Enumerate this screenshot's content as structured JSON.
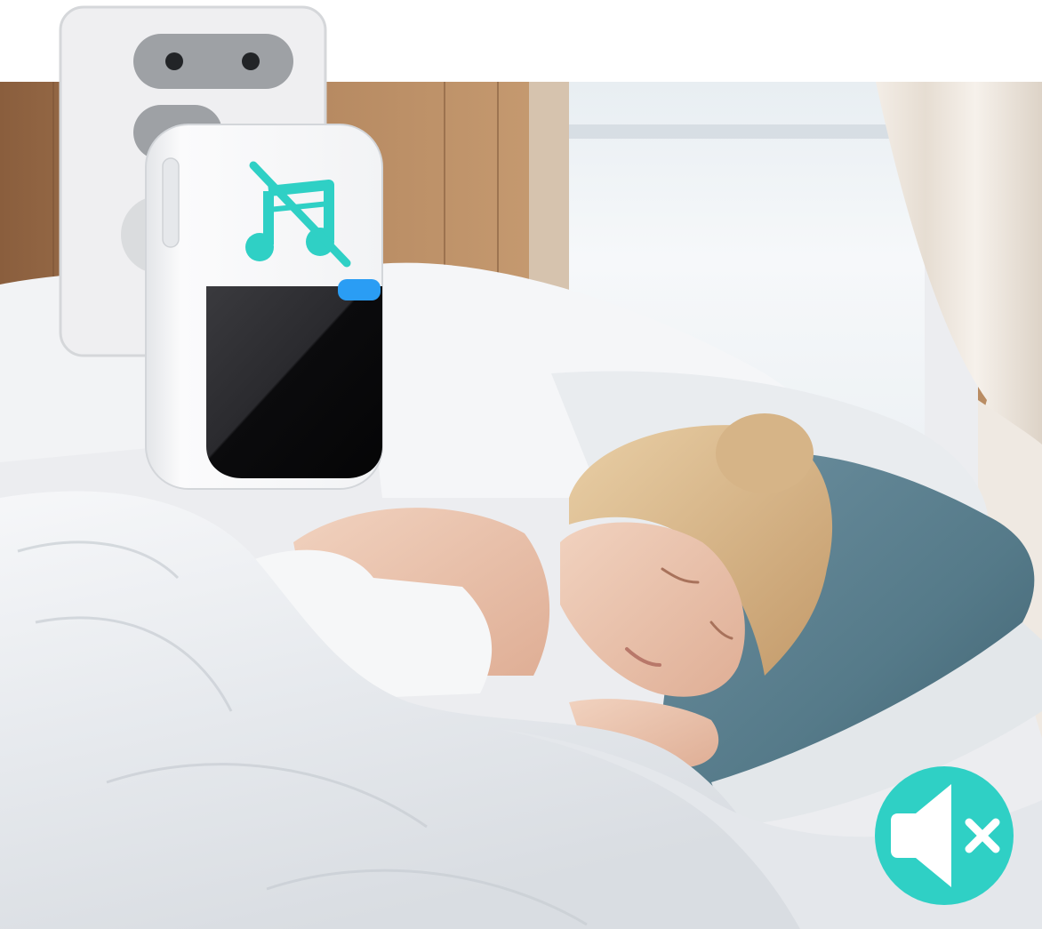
{
  "scene": {
    "subject": "child-sleeping-in-bed",
    "device": "plug-in-doorbell-receiver",
    "device_icon": "music-note-off-icon",
    "device_indicator_color": "#2a9df4",
    "badge_icon": "speaker-mute-icon"
  },
  "colors": {
    "accent_teal": "#2fd0c5",
    "device_white": "#f7f8f9",
    "device_panel": "#0c0c0e",
    "pillow_blue": "#5a7f8e",
    "bedding_white": "#eef0f2",
    "wood": "#a67852"
  }
}
